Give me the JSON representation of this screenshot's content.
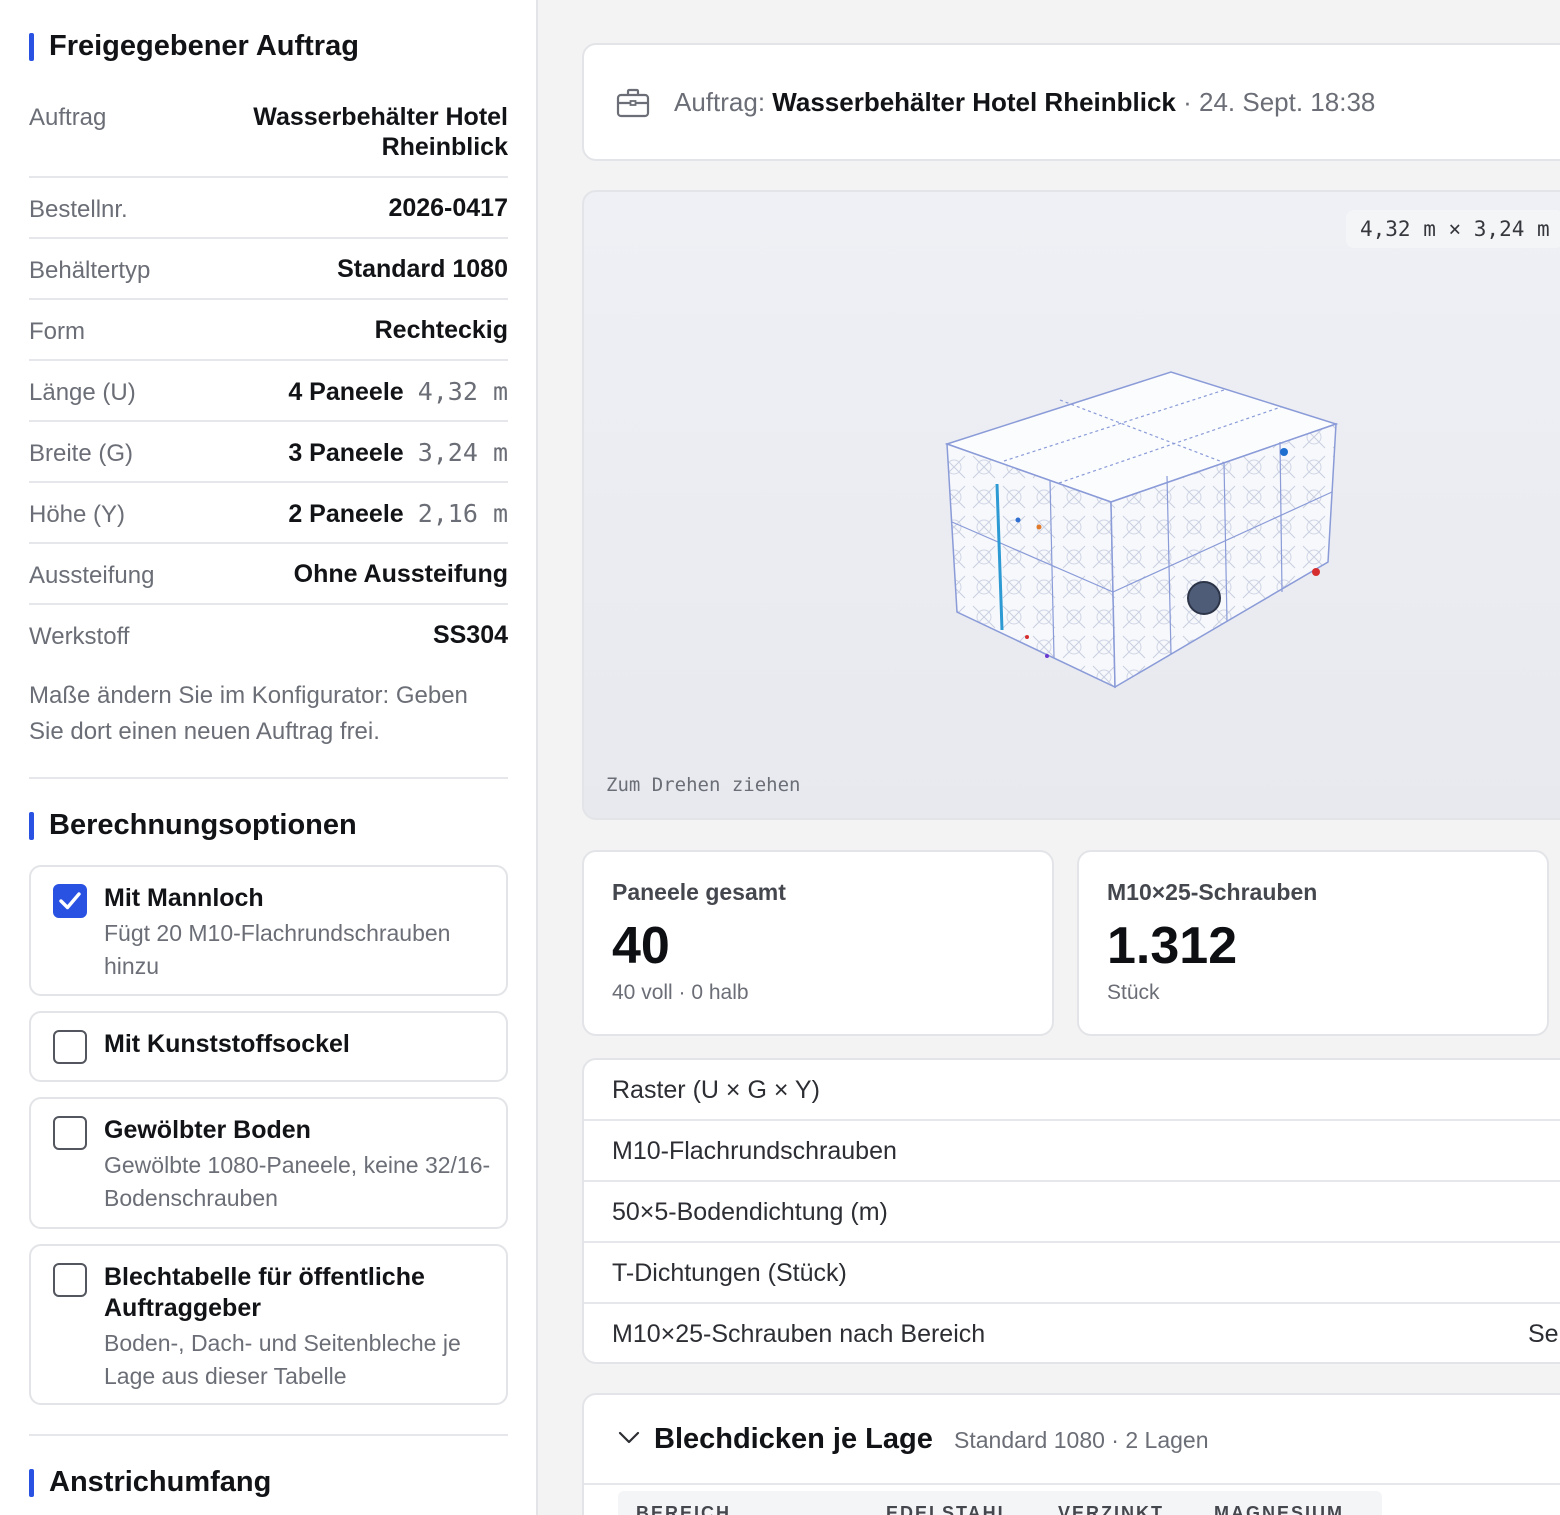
{
  "released_order": {
    "title": "Freigegebener Auftrag",
    "rows": [
      {
        "label": "Auftrag",
        "value": "Wasserbehälter Hotel Rheinblick"
      },
      {
        "label": "Bestellnr.",
        "value": "2026-0417"
      },
      {
        "label": "Behältertyp",
        "value": "Standard 1080"
      },
      {
        "label": "Form",
        "value": "Rechteckig"
      },
      {
        "label": "Länge (U)",
        "value": "4 Paneele",
        "measure": "4,32 m"
      },
      {
        "label": "Breite (G)",
        "value": "3 Paneele",
        "measure": "3,24 m"
      },
      {
        "label": "Höhe (Y)",
        "value": "2 Paneele",
        "measure": "2,16 m"
      },
      {
        "label": "Aussteifung",
        "value": "Ohne Aussteifung"
      },
      {
        "label": "Werkstoff",
        "value": "SS304"
      }
    ],
    "note": "Maße ändern Sie im Konfigurator: Geben Sie dort einen neuen Auftrag frei."
  },
  "calc_options": {
    "title": "Berechnungsoptionen",
    "options": [
      {
        "title": "Mit Mannloch",
        "desc": "Fügt 20 M10-Flachrundschrauben hinzu",
        "checked": true
      },
      {
        "title": "Mit Kunststoffsockel",
        "desc": "",
        "checked": false
      },
      {
        "title": "Gewölbter Boden",
        "desc": "Gewölbte 1080-Paneele, keine 32/16-Bodenschrauben",
        "checked": false
      },
      {
        "title": "Blechtabelle für öffentliche Auftraggeber",
        "desc": "Boden-, Dach- und Seitenbleche je Lage aus dieser Tabelle",
        "checked": false
      }
    ]
  },
  "coating": {
    "title": "Anstrichumfang"
  },
  "order_card": {
    "prefix": "Auftrag:",
    "name": "Wasserbehälter Hotel Rheinblick",
    "meta": " · 24. Sept. 18:38",
    "icon": "briefcase-icon"
  },
  "viewer": {
    "dimensions": "4,32 m × 3,24 m",
    "hint": "Zum Drehen ziehen"
  },
  "stats": [
    {
      "label": "Paneele gesamt",
      "value": "40",
      "sub": "40 voll · 0 halb"
    },
    {
      "label": "M10×25-Schrauben",
      "value": "1.312",
      "sub": "Stück"
    }
  ],
  "summary_rows": [
    {
      "label": "Raster (U × G × Y)",
      "value": ""
    },
    {
      "label": "M10-Flachrundschrauben",
      "value": ""
    },
    {
      "label": "50×5-Bodendichtung (m)",
      "value": ""
    },
    {
      "label": "T-Dichtungen (Stück)",
      "value": ""
    },
    {
      "label": "M10×25-Schrauben nach Bereich",
      "value": "Se"
    }
  ],
  "thickness": {
    "title": "Blechdicken je Lage",
    "meta": "Standard 1080 · 2 Lagen",
    "columns": [
      "BEREICH",
      "EDELSTAHL",
      "VERZINKT",
      "MAGNESIUM"
    ]
  },
  "colors": {
    "accent": "#2952e3"
  }
}
